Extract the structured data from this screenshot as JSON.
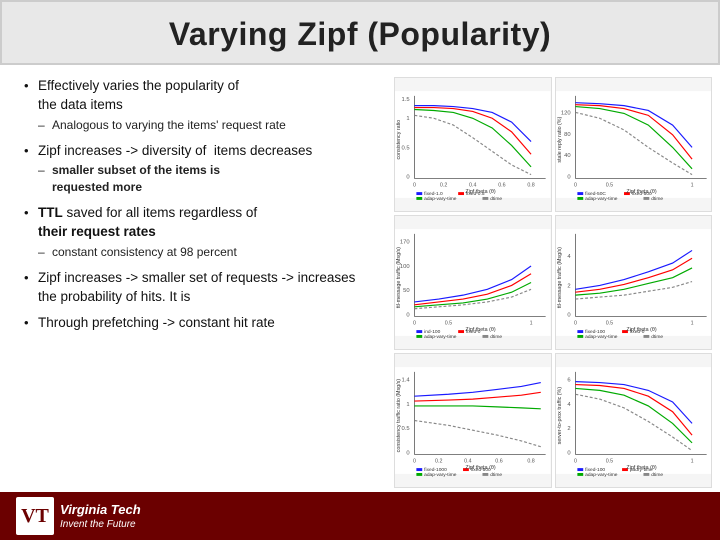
{
  "slide": {
    "title": "Varying Zipf (Popularity)",
    "bullets": [
      {
        "id": "b1",
        "text": "Effectively varies the popularity of the data items",
        "sub": [
          {
            "id": "b1s1",
            "text": "Analogous to varying the items' request rate"
          }
        ]
      },
      {
        "id": "b2",
        "text": "Zipf increases -> diversity of  items decreases",
        "sub": [
          {
            "id": "b2s1",
            "text": "smaller subset of the items is requested more"
          }
        ]
      },
      {
        "id": "b3",
        "text": "TTL saved for all items regardless of their request rates",
        "sub": [
          {
            "id": "b3s1",
            "text": "constant consistency at 98 percent"
          }
        ]
      },
      {
        "id": "b4",
        "text": "Zipf increases -> smaller set of requests -> increases the probability of hits. It is"
      },
      {
        "id": "b5",
        "text": "Through prefetching -> constant hit rate"
      }
    ],
    "footer": {
      "logo_text": "VT",
      "university_name": "Virginia Tech",
      "tagline": "Invent the Future"
    },
    "charts": [
      {
        "id": "c1",
        "label": "chart-top-left"
      },
      {
        "id": "c2",
        "label": "chart-top-right"
      },
      {
        "id": "c3",
        "label": "chart-mid-left"
      },
      {
        "id": "c4",
        "label": "chart-mid-right"
      },
      {
        "id": "c5",
        "label": "chart-bot-left"
      },
      {
        "id": "c6",
        "label": "chart-bot-right"
      }
    ]
  }
}
